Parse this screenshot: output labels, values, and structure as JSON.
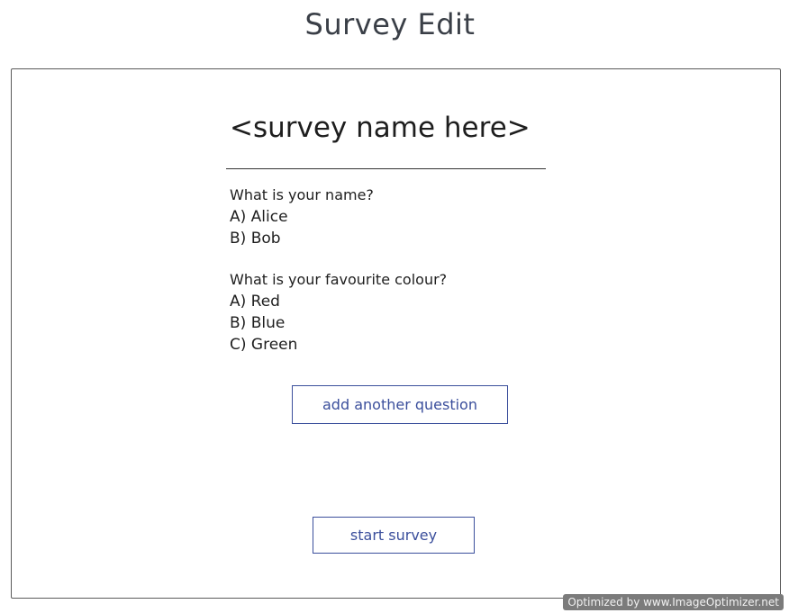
{
  "page": {
    "title": "Survey Edit"
  },
  "survey": {
    "name": "<survey name here>",
    "questions": [
      {
        "text": "What is your name?",
        "answers": [
          "A) Alice",
          "B) Bob"
        ]
      },
      {
        "text": "What is your favourite colour?",
        "answers": [
          "A) Red",
          "B) Blue",
          "C) Green"
        ]
      }
    ],
    "add_question_label": "add another question",
    "start_label": "start survey"
  },
  "watermark": "Optimized by www.ImageOptimizer.net",
  "colors": {
    "button_accent": "#3b4f9c",
    "frame_border": "#5a5a5a"
  }
}
